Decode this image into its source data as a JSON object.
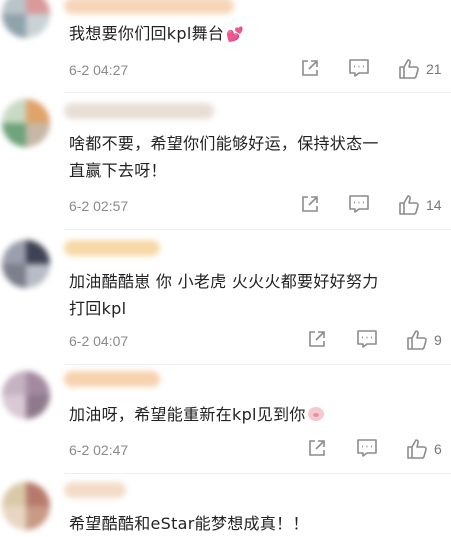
{
  "comments": [
    {
      "avatar_colors": [
        "#b9c4c9",
        "#d99a9a",
        "#8fa3ad",
        "#c9d3d6"
      ],
      "name_color": "#f6d6b8",
      "text_line1": "我想要你们回kpl舞台",
      "text_line2": "",
      "emoji": "heart-emoji-icon",
      "time": "6-2 04:27",
      "likes": "21"
    },
    {
      "avatar_colors": [
        "#c9d9c4",
        "#e0a36a",
        "#6fa37a",
        "#c6b7a6"
      ],
      "name_color": "#e8ded6",
      "text_line1": "啥都不要，希望你们能够好运，保持状态一",
      "text_line2": "直赢下去呀！",
      "emoji": "",
      "time": "6-2 02:57",
      "likes": "14"
    },
    {
      "avatar_colors": [
        "#9a9fae",
        "#3f4253",
        "#7c7f8c",
        "#b8bcc6"
      ],
      "name_color": "#f7d9a8",
      "text_line1": "加油酷酷崽 你 小老虎 火火火都要好好努力",
      "text_line2": "打回kpl",
      "emoji": "",
      "time": "6-2 04:07",
      "likes": "9"
    },
    {
      "avatar_colors": [
        "#c5b2c2",
        "#a48aa1",
        "#d9c9d5",
        "#8e7a8c"
      ],
      "name_color": "#f7d2ae",
      "text_line1": "加油呀，希望能重新在kpl见到你",
      "text_line2": "",
      "emoji": "pig-emoji-icon",
      "time": "6-2 02:47",
      "likes": "6"
    },
    {
      "avatar_colors": [
        "#d9c9a8",
        "#b77a6a",
        "#e8d6c2",
        "#c99a86"
      ],
      "name_color": "#f3dcc8",
      "text_line1": "希望酷酷和eStar能梦想成真！！",
      "text_line2": "",
      "emoji": "",
      "time": "",
      "likes": ""
    }
  ],
  "icons": {
    "share": "share-icon",
    "reply": "comment-icon",
    "like": "thumbs-up-icon"
  },
  "colors": {
    "text": "#222222",
    "meta": "#8a8a8a",
    "icon": "#8c8c8c"
  }
}
